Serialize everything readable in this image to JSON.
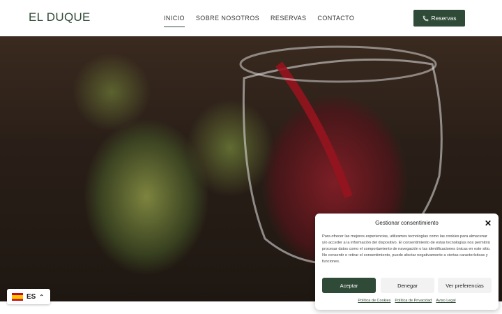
{
  "header": {
    "logo": "EL DUQUE",
    "nav": [
      "INICIO",
      "SOBRE NOSOTROS",
      "RESERVAS",
      "CONTACTO"
    ],
    "cta_label": "Reservas",
    "cta_icon": "phone-icon"
  },
  "language": {
    "code": "ES",
    "flag": "spain-flag-icon"
  },
  "consent": {
    "title": "Gestionar consentimiento",
    "text": "Para ofrecer las mejores experiencias, utilizamos tecnologías como las cookies para almacenar y/o acceder a la información del dispositivo. El consentimiento de estas tecnologías nos permitirá procesar datos como el comportamiento de navegación o las identificaciones únicas en este sitio. No consentir o retirar el consentimiento, puede afectar negativamente a ciertas características y funciones.",
    "accept": "Aceptar",
    "deny": "Denegar",
    "preferences": "Ver preferencias",
    "links": [
      "Política de Cookies",
      "Política de Privacidad",
      "Aviso Legal"
    ]
  },
  "colors": {
    "brand": "#2f4a37"
  }
}
